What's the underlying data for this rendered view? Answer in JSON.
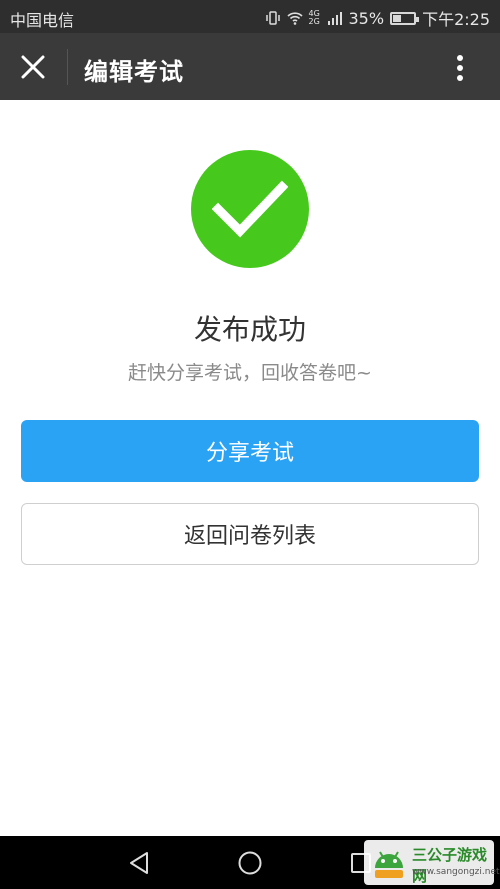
{
  "status": {
    "carrier": "中国电信",
    "network": "4G 2G",
    "battery_text": "35%",
    "battery_level": 0.35,
    "time": "下午2:25"
  },
  "header": {
    "title": "编辑考试",
    "close_icon": "close-icon",
    "more_icon": "more-vertical-icon"
  },
  "result": {
    "icon": "checkmark-icon",
    "icon_color": "#46c81c",
    "headline": "发布成功",
    "subline": "赶快分享考试，回收答卷吧~"
  },
  "actions": {
    "share_label": "分享考试",
    "back_label": "返回问卷列表",
    "primary_color": "#2ba3f5"
  },
  "watermark": {
    "name": "三公子游戏网",
    "url": "www.sangongzi.net"
  }
}
